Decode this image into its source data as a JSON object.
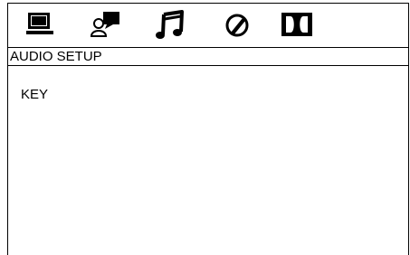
{
  "menu": {
    "tabs": [
      {
        "icon": "monitor-icon"
      },
      {
        "icon": "speaker-setup-icon"
      },
      {
        "icon": "music-note-icon"
      },
      {
        "icon": "preference-dial-icon"
      },
      {
        "icon": "dolby-icon"
      }
    ],
    "active_tab": "music-note-icon",
    "section_title": "AUDIO SETUP",
    "items": [
      {
        "label": "KEY"
      }
    ]
  }
}
